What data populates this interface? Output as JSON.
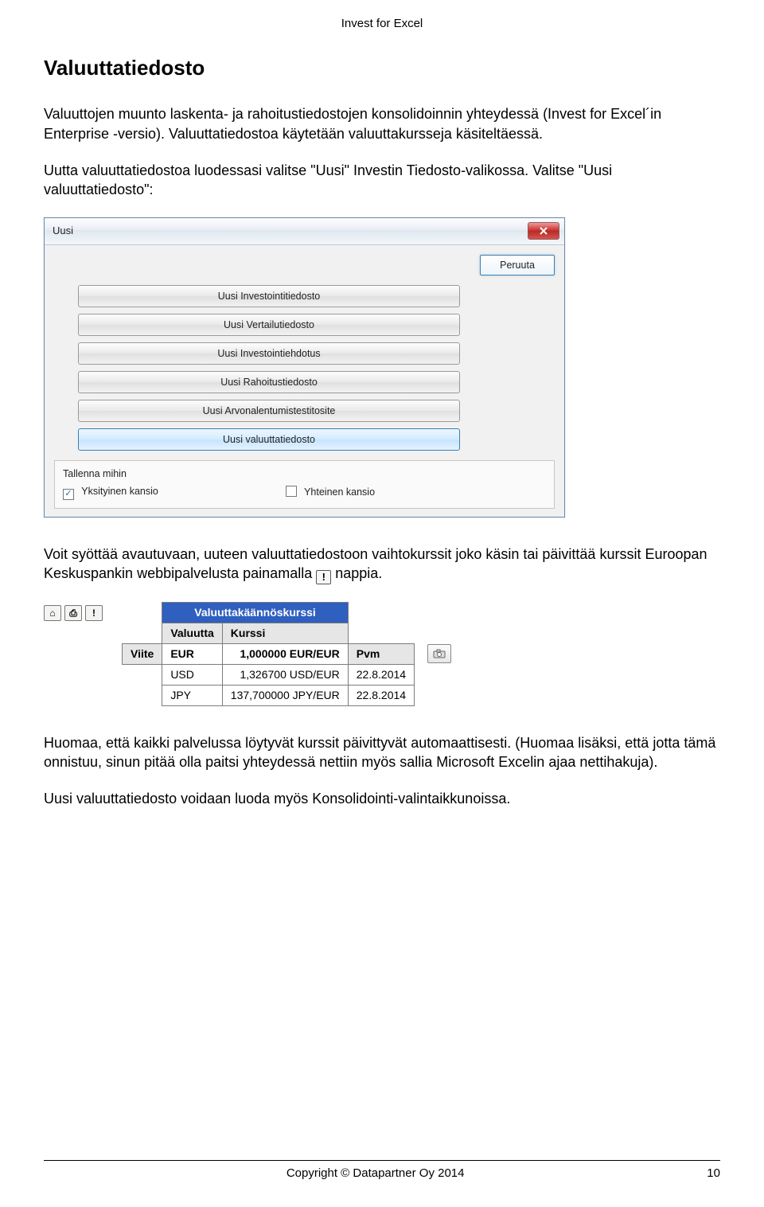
{
  "header": {
    "title": "Invest for Excel"
  },
  "section": {
    "title": "Valuuttatiedosto"
  },
  "paragraphs": {
    "p1": "Valuuttojen muunto laskenta- ja rahoitustiedostojen konsolidoinnin yhteydessä (Invest for Excel´in Enterprise -versio). Valuuttatiedostoa käytetään valuuttakursseja käsiteltäessä.",
    "p2": "Uutta valuuttatiedostoa luodessasi valitse \"Uusi\" Investin Tiedosto-valikossa. Valitse \"Uusi valuuttatiedosto\":",
    "p3a": "Voit syöttää avautuvaan, uuteen valuuttatiedostoon vaihtokurssit joko käsin tai päivittää kurssit Euroopan Keskuspankin webbipalvelusta painamalla",
    "p3b": "nappia.",
    "p4": "Huomaa, että kaikki palvelussa löytyvät kurssit päivittyvät automaattisesti. (Huomaa lisäksi, että jotta tämä onnistuu, sinun pitää olla paitsi yhteydessä nettiin myös sallia Microsoft Excelin ajaa nettihakuja).",
    "p5": "Uusi valuuttatiedosto voidaan luoda myös Konsolidointi-valintaikkunoissa."
  },
  "dialog": {
    "title": "Uusi",
    "cancel": "Peruuta",
    "options": [
      {
        "label": "Uusi Investointitiedosto",
        "active": false
      },
      {
        "label": "Uusi Vertailutiedosto",
        "active": false
      },
      {
        "label": "Uusi Investointiehdotus",
        "active": false
      },
      {
        "label": "Uusi Rahoitustiedosto",
        "active": false
      },
      {
        "label": "Uusi Arvonalentumistestitosite",
        "active": false
      },
      {
        "label": "Uusi valuuttatiedosto",
        "active": true
      }
    ],
    "save_label": "Tallenna mihin",
    "chk_private": "Yksityinen kansio",
    "chk_shared": "Yhteinen kansio"
  },
  "icons": {
    "exclaim": "!",
    "home": "⌂",
    "print": "⎙"
  },
  "currency": {
    "header": "Valuuttakäännöskurssi",
    "col_currency": "Valuutta",
    "col_rate": "Kurssi",
    "ref_label": "Viite",
    "pvm_label": "Pvm",
    "rows": [
      {
        "cur": "EUR",
        "rate": "1,000000 EUR/EUR",
        "date": ""
      },
      {
        "cur": "USD",
        "rate": "1,326700 USD/EUR",
        "date": "22.8.2014"
      },
      {
        "cur": "JPY",
        "rate": "137,700000 JPY/EUR",
        "date": "22.8.2014"
      }
    ]
  },
  "footer": {
    "copyright": "Copyright © Datapartner Oy 2014",
    "page": "10"
  }
}
